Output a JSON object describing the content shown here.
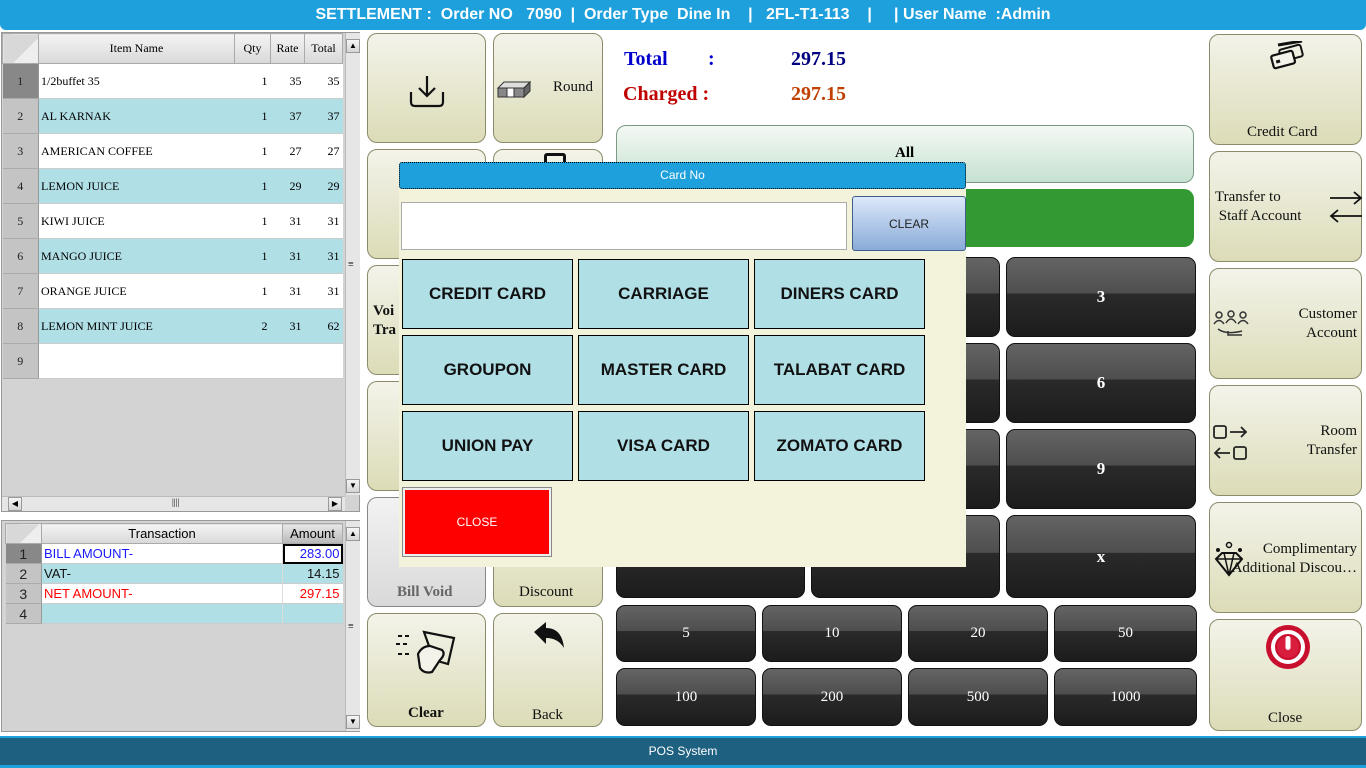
{
  "header": {
    "title": "SETTLEMENT :  Order NO   7090  |  Order Type  Dine In    |   2FL-T1-113    |     | User Name  :Admin"
  },
  "items_grid": {
    "columns": [
      "Item Name",
      "Qty",
      "Rate",
      "Total"
    ],
    "rows": [
      {
        "no": "1",
        "name": "1/2buffet 35",
        "qty": "1",
        "rate": "35",
        "total": "35"
      },
      {
        "no": "2",
        "name": "AL KARNAK",
        "qty": "1",
        "rate": "37",
        "total": "37"
      },
      {
        "no": "3",
        "name": "AMERICAN COFFEE",
        "qty": "1",
        "rate": "27",
        "total": "27"
      },
      {
        "no": "4",
        "name": "LEMON JUICE",
        "qty": "1",
        "rate": "29",
        "total": "29"
      },
      {
        "no": "5",
        "name": "KIWI JUICE",
        "qty": "1",
        "rate": "31",
        "total": "31"
      },
      {
        "no": "6",
        "name": "MANGO JUICE",
        "qty": "1",
        "rate": "31",
        "total": "31"
      },
      {
        "no": "7",
        "name": "ORANGE JUICE",
        "qty": "1",
        "rate": "31",
        "total": "31"
      },
      {
        "no": "8",
        "name": "LEMON MINT JUICE",
        "qty": "2",
        "rate": "31",
        "total": "62"
      },
      {
        "no": "9",
        "name": "",
        "qty": "",
        "rate": "",
        "total": ""
      }
    ]
  },
  "transactions_grid": {
    "columns": [
      "Transaction",
      "Amount"
    ],
    "rows": [
      {
        "no": "1",
        "label": "BILL AMOUNT-",
        "amount": "283.00",
        "color": "#1a1aff"
      },
      {
        "no": "2",
        "label": "VAT-",
        "amount": "14.15",
        "color": "#111111"
      },
      {
        "no": "3",
        "label": "NET AMOUNT-",
        "amount": "297.15",
        "color": "#ff0000"
      },
      {
        "no": "4",
        "label": "",
        "amount": "",
        "color": "#111111"
      }
    ]
  },
  "actions": {
    "round": "Round",
    "void_transaction_partial": "Voi\nTra",
    "bill_void": "Bill Void",
    "discount": "Discount",
    "clear": "Clear",
    "back": "Back"
  },
  "totals": {
    "total_label": "Total",
    "total_colon": ":",
    "total_value": "297.15",
    "charged_label": "Charged :",
    "charged_value": "297.15",
    "total_color": "#0000cc",
    "total_value_color": "#000080",
    "charged_color": "#c00000",
    "charged_value_color": "#c04000"
  },
  "all_button": "All",
  "keypad": {
    "visible_keys": [
      "3",
      "6",
      "9",
      "x"
    ],
    "denominations": [
      "5",
      "10",
      "20",
      "50",
      "100",
      "200",
      "500",
      "1000"
    ]
  },
  "side_menu": [
    {
      "label": "Credit Card",
      "icon": "credit-card-icon"
    },
    {
      "label": "Transfer to\n Staff Account",
      "icon": "transfer-arrows-icon"
    },
    {
      "label": "Customer\nAccount",
      "icon": "customer-group-icon"
    },
    {
      "label": "Room\nTransfer",
      "icon": "room-transfer-icon"
    },
    {
      "label": "Complimentary\nAdditional Discou…",
      "icon": "diamond-icon"
    },
    {
      "label": "Close",
      "icon": "power-icon"
    }
  ],
  "dialog": {
    "title": "Card No",
    "input_value": "",
    "clear_label": "CLEAR",
    "cards": [
      "CREDIT CARD",
      "CARRIAGE",
      "DINERS CARD",
      "GROUPON",
      "MASTER CARD",
      "TALABAT CARD",
      "UNION PAY",
      "VISA CARD",
      "ZOMATO CARD"
    ],
    "close_label": "CLOSE"
  },
  "footer": {
    "label": "POS System"
  }
}
